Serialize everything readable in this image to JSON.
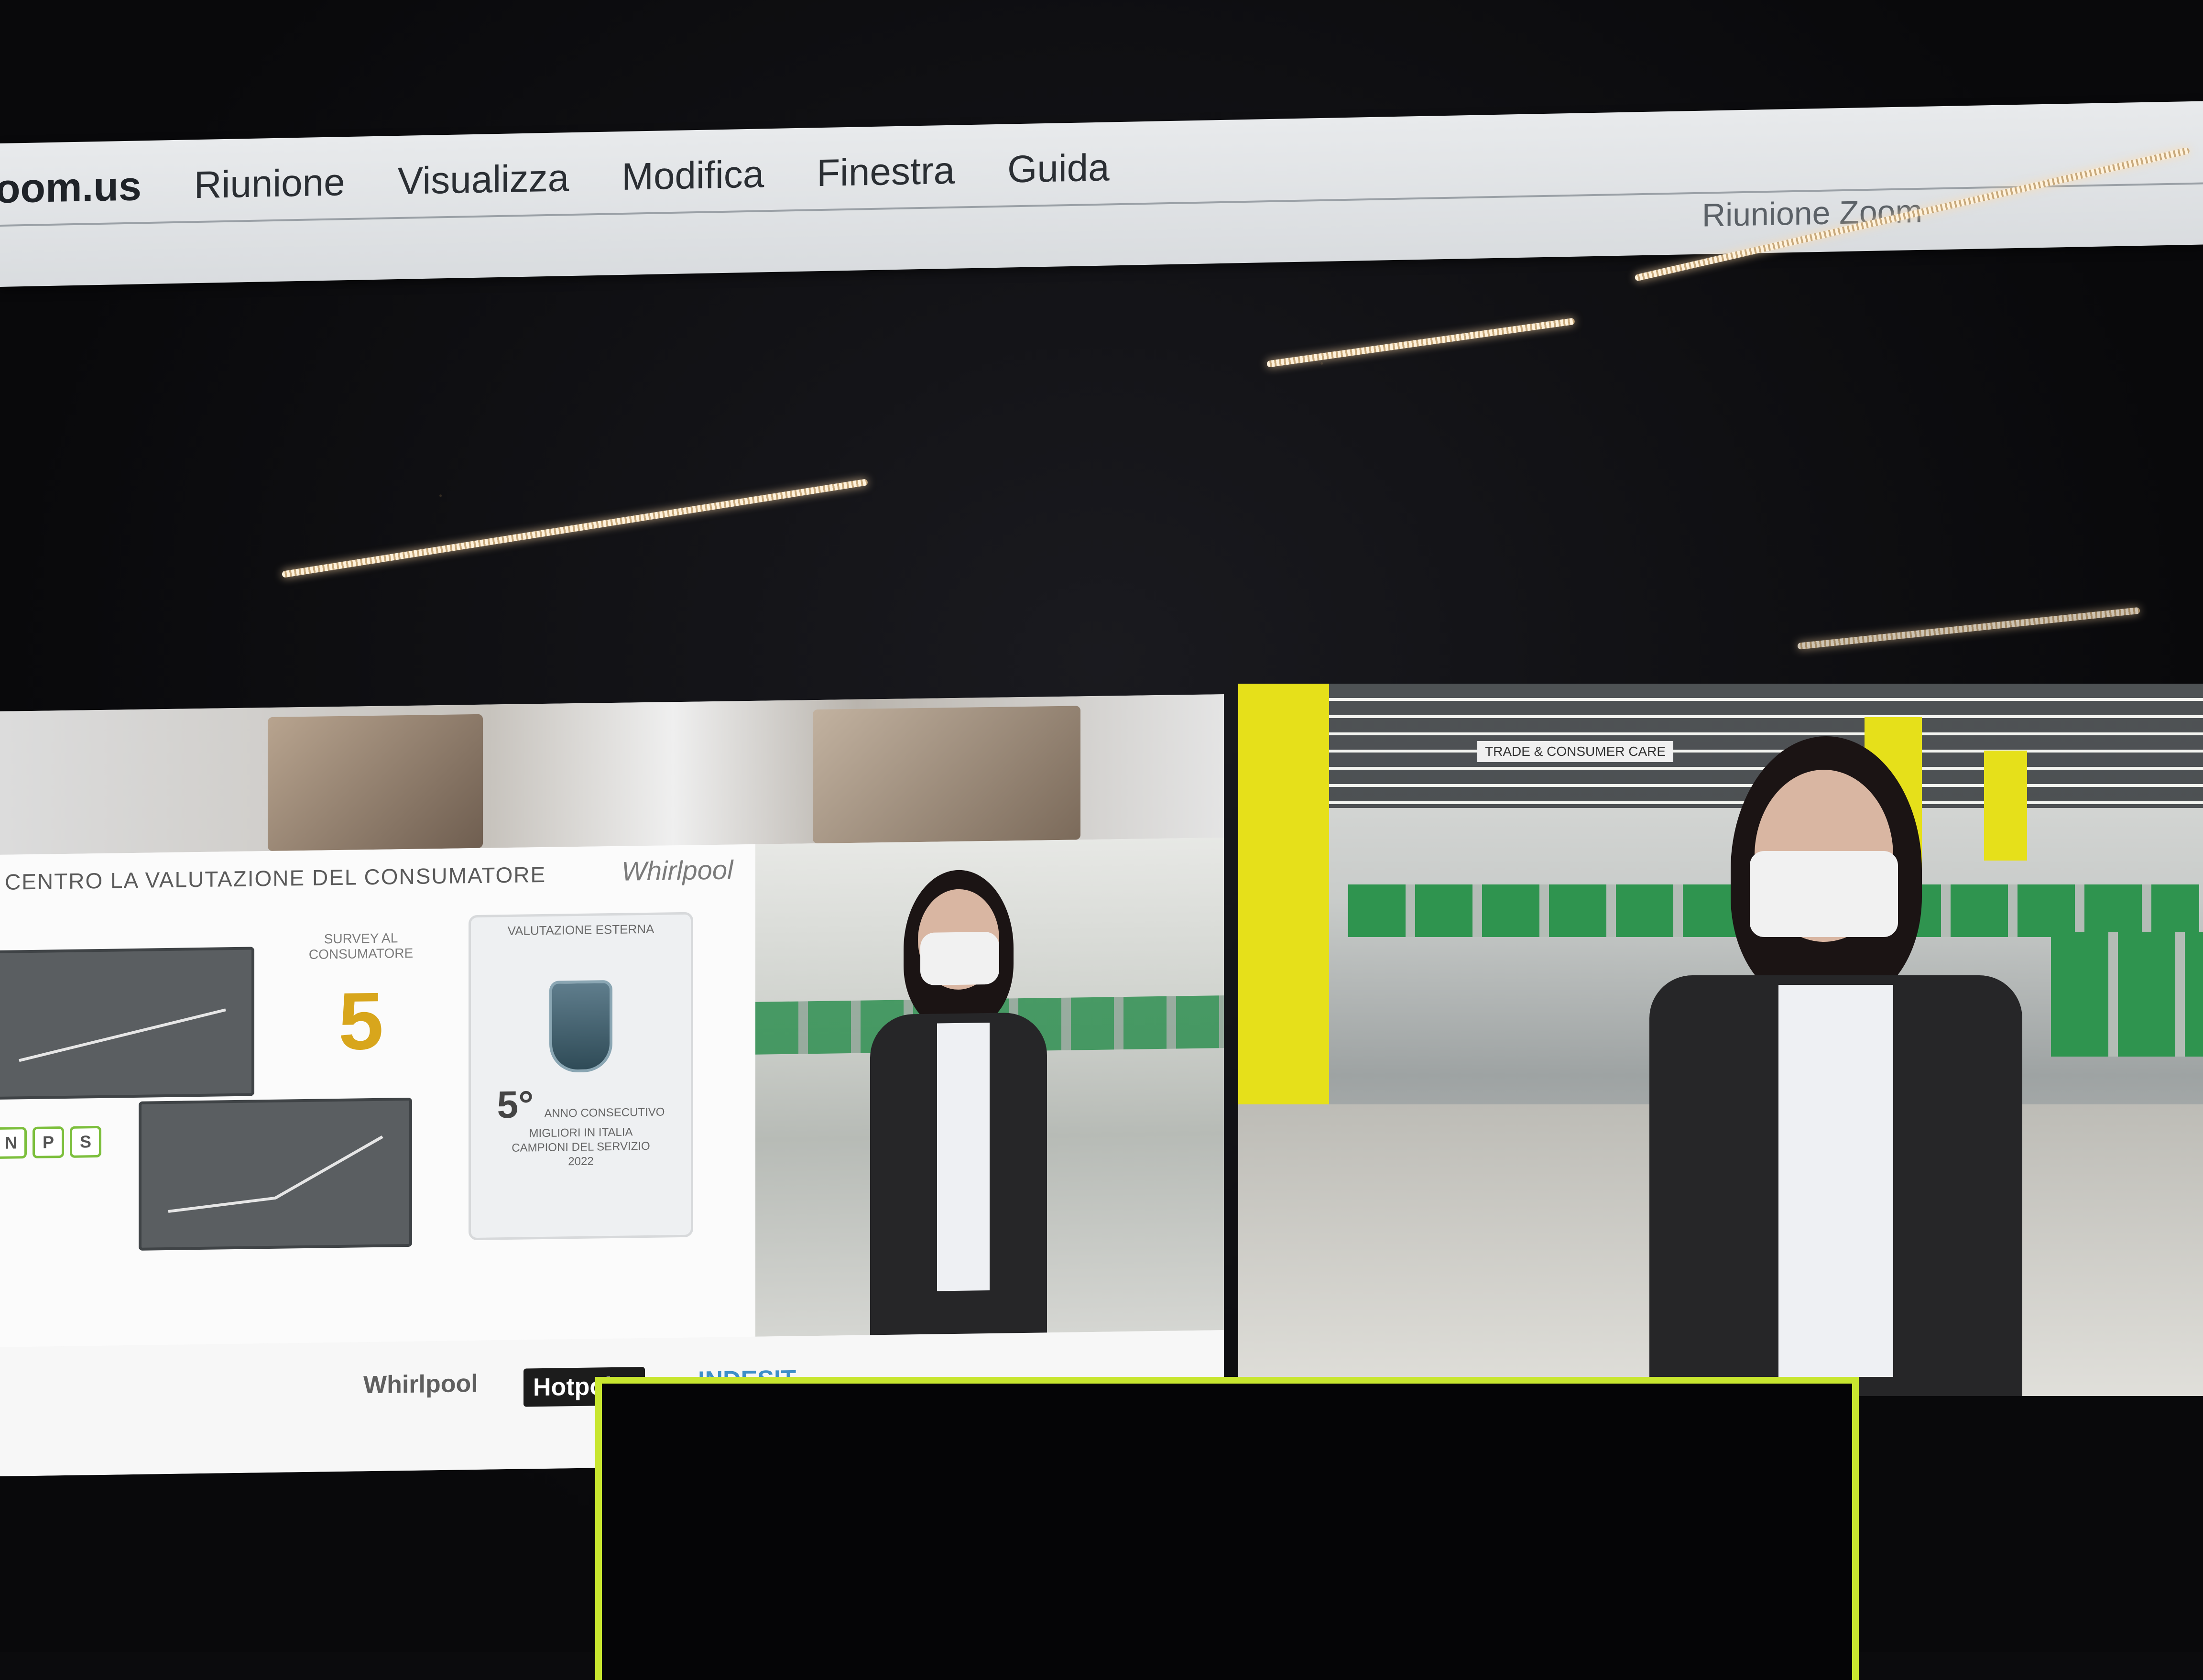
{
  "menubar": {
    "app_name": "oom.us",
    "menus": [
      "Riunione",
      "Visualizza",
      "Modifica",
      "Finestra",
      "Guida"
    ],
    "window_title": "Riunione Zoom"
  },
  "slide": {
    "title": "CENTRO LA VALUTAZIONE  DEL CONSUMATORE",
    "brand": "Whirlpool",
    "survey_label": "SURVEY AL CONSUMATORE",
    "survey_number": "5",
    "badge_label": "VALUTAZIONE ESTERNA",
    "badge_rank": "5°",
    "badge_rank_sub": "ANNO CONSECUTIVO",
    "badge_caption_1": "MIGLIORI IN ITALIA",
    "badge_caption_2": "CAMPIONI DEL SERVIZIO",
    "badge_year": "2022",
    "nps_letters": [
      "N",
      "P",
      "S"
    ],
    "logos": [
      "Whirlpool",
      "Hotpoint",
      "INDESIT"
    ]
  },
  "right_tile": {
    "sign_text": "TRADE & CONSUMER CARE"
  },
  "colors": {
    "menubar_bg": "#e0e3e6",
    "active_speaker_border": "#c8e62f",
    "desk_green": "#2f944f",
    "pillar_yellow": "#e6e01a"
  }
}
